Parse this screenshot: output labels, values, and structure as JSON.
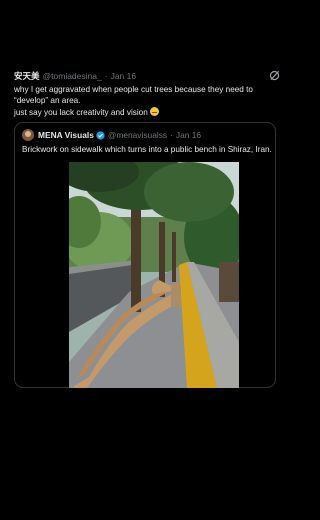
{
  "tweet": {
    "author_name": "安天美",
    "handle": "@tomiadesina_",
    "separator": "·",
    "date": "Jan 16",
    "lines": [
      "why I get aggravated when people cut trees because they need to",
      "“develop” an area.",
      "just say you lack creativity and vision"
    ],
    "emoji": "grimace-emoji",
    "grok_icon": "grok-icon"
  },
  "quote": {
    "author_name": "MENA Visuals",
    "handle": "@menavisualss",
    "separator": "·",
    "date": "Jan 16",
    "text": "Brickwork on sidewalk which turns into a public bench in Shiraz, Iran.",
    "verified_icon": "verified-badge-icon",
    "photo": "sidewalk-bench-photo"
  },
  "colors": {
    "background": "#000000",
    "text": "#e7e9ea",
    "muted": "#71767b",
    "border": "#2f3336",
    "verified": "#1d9bf0"
  }
}
